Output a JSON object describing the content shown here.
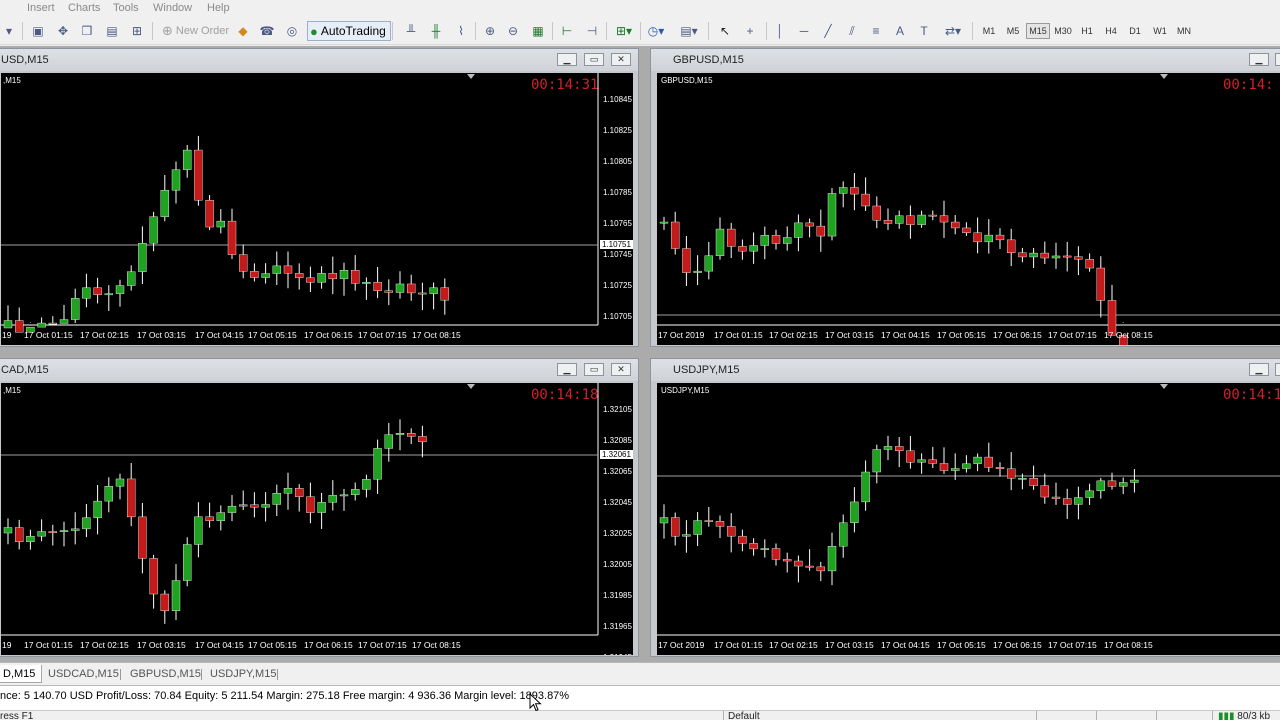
{
  "menu": [
    "Insert",
    "Charts",
    "Tools",
    "Window",
    "Help"
  ],
  "toolbar": {
    "new_order": "New Order",
    "autotrading": "AutoTrading",
    "timeframes": [
      "M1",
      "M5",
      "M15",
      "M30",
      "H1",
      "H4",
      "D1",
      "W1",
      "MN"
    ],
    "active_timeframe": "M15"
  },
  "windows": [
    {
      "title": "USD,M15",
      "symbol_label": ",M15",
      "timer": "00:14:31",
      "price_labels": [
        "1.10845",
        "1.10825",
        "1.10805",
        "1.10785",
        "1.10765",
        "1.10745",
        "1.10725",
        "1.10705"
      ],
      "current_price": "1.10751",
      "time_labels": [
        "19",
        "17 Oct 01:15",
        "17 Oct 02:15",
        "17 Oct 03:15",
        "17 Oct 04:15",
        "17 Oct 05:15",
        "17 Oct 06:15",
        "17 Oct 07:15",
        "17 Oct 08:15"
      ]
    },
    {
      "title": "GBPUSD,M15",
      "symbol_label": "GBPUSD,M15",
      "timer": "00:14:",
      "price_labels": [],
      "current_price": "",
      "time_labels": [
        "17 Oct 2019",
        "17 Oct 01:15",
        "17 Oct 02:15",
        "17 Oct 03:15",
        "17 Oct 04:15",
        "17 Oct 05:15",
        "17 Oct 06:15",
        "17 Oct 07:15",
        "17 Oct 08:15"
      ]
    },
    {
      "title": "CAD,M15",
      "symbol_label": ",M15",
      "timer": "00:14:18",
      "price_labels": [
        "1.32105",
        "1.32085",
        "1.32065",
        "1.32045",
        "1.32025",
        "1.32005",
        "1.31985",
        "1.31965",
        "1.31945"
      ],
      "current_price": "1.32061",
      "time_labels": [
        "19",
        "17 Oct 01:15",
        "17 Oct 02:15",
        "17 Oct 03:15",
        "17 Oct 04:15",
        "17 Oct 05:15",
        "17 Oct 06:15",
        "17 Oct 07:15",
        "17 Oct 08:15"
      ]
    },
    {
      "title": "USDJPY,M15",
      "symbol_label": "USDJPY,M15",
      "timer": "00:14:1",
      "price_labels": [],
      "current_price": "",
      "time_labels": [
        "17 Oct 2019",
        "17 Oct 01:15",
        "17 Oct 02:15",
        "17 Oct 03:15",
        "17 Oct 04:15",
        "17 Oct 05:15",
        "17 Oct 06:15",
        "17 Oct 07:15",
        "17 Oct 08:15"
      ]
    }
  ],
  "tabs": [
    {
      "label": "D,M15",
      "active": true
    },
    {
      "label": "USDCAD,M15",
      "active": false
    },
    {
      "label": "GBPUSD,M15",
      "active": false
    },
    {
      "label": "USDJPY,M15",
      "active": false
    }
  ],
  "terminal": {
    "balance_line": "nce: 5 140.70 USD  Profit/Loss: 70.84  Equity: 5 211.54  Margin: 275.18  Free margin: 4 936.36  Margin level: 1893.87%"
  },
  "status": {
    "left": "ress F1",
    "profile": "Default",
    "connection": "80/3 kb"
  },
  "colors": {
    "bull": "#1fa21f",
    "bear": "#c41a1a",
    "chart_bg": "#000000",
    "timer": "#d0202a",
    "bid_line": "#a0a0a0"
  }
}
